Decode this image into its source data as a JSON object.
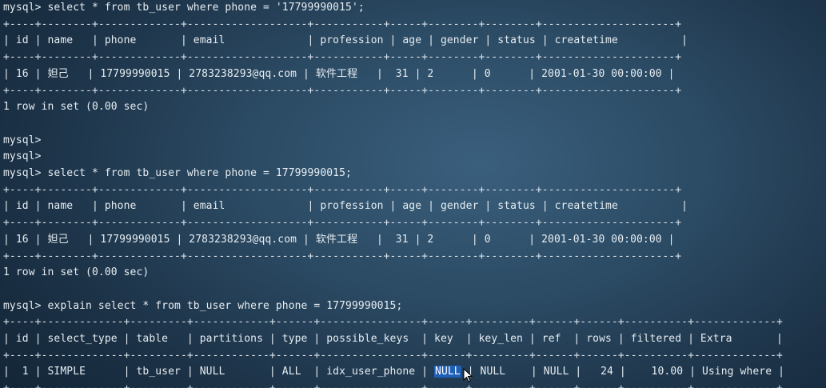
{
  "window": {
    "title": ""
  },
  "terminal": {
    "lines": [
      {
        "text": "mysql> select * from tb_user where phone = '17799990015';",
        "kind": "command"
      },
      {
        "text": "+----+--------+-------------+-------------------+-----------+-----+--------+--------+---------------------+",
        "kind": "border"
      },
      {
        "text": "| id | name   | phone       | email             | profession | age | gender | status | createtime          |",
        "kind": "row"
      },
      {
        "text": "+----+--------+-------------+-------------------+-----------+-----+--------+--------+---------------------+",
        "kind": "border"
      },
      {
        "text": "| 16 | 妲己   | 17799990015 | 2783238293@qq.com | 软件工程   |  31 | 2      | 0      | 2001-01-30 00:00:00 |",
        "kind": "row"
      },
      {
        "text": "+----+--------+-------------+-------------------+-----------+-----+--------+--------+---------------------+",
        "kind": "border"
      },
      {
        "text": "1 row in set (0.00 sec)",
        "kind": "output"
      },
      {
        "text": "",
        "kind": "blank"
      },
      {
        "text": "mysql>",
        "kind": "command"
      },
      {
        "text": "mysql>",
        "kind": "command"
      },
      {
        "text": "mysql> select * from tb_user where phone = 17799990015;",
        "kind": "command"
      },
      {
        "text": "+----+--------+-------------+-------------------+-----------+-----+--------+--------+---------------------+",
        "kind": "border"
      },
      {
        "text": "| id | name   | phone       | email             | profession | age | gender | status | createtime          |",
        "kind": "row"
      },
      {
        "text": "+----+--------+-------------+-------------------+-----------+-----+--------+--------+---------------------+",
        "kind": "border"
      },
      {
        "text": "| 16 | 妲己   | 17799990015 | 2783238293@qq.com | 软件工程   |  31 | 2      | 0      | 2001-01-30 00:00:00 |",
        "kind": "row"
      },
      {
        "text": "+----+--------+-------------+-------------------+-----------+-----+--------+--------+---------------------+",
        "kind": "border"
      },
      {
        "text": "1 row in set (0.00 sec)",
        "kind": "output"
      },
      {
        "text": "",
        "kind": "blank"
      },
      {
        "text": "mysql> explain select * from tb_user where phone = 17799990015;",
        "kind": "command"
      },
      {
        "text": "+----+-------------+---------+------------+------+----------------+------+---------+------+------+----------+-------------+",
        "kind": "border"
      },
      {
        "text": "| id | select_type | table   | partitions | type | possible_keys  | key  | key_len | ref  | rows | filtered | Extra       |",
        "kind": "row"
      },
      {
        "text": "+----+-------------+---------+------------+------+----------------+------+---------+------+------+----------+-------------+",
        "kind": "border"
      },
      {
        "text": "|  1 | SIMPLE      | tb_user | NULL       | ALL  | idx_user_phone | ",
        "kind": "row",
        "highlight": "NULL",
        "after": " | NULL    | NULL |   24 |    10.00 | Using where |"
      },
      {
        "text": "+----+-------------+---------+------------+------+----------------+------+---------+------+------+----------+-------------+",
        "kind": "border"
      }
    ]
  },
  "colors": {
    "text": "#e6edf2",
    "selection": "#1e5fb8",
    "background": "#2b4a63"
  },
  "icons": {
    "pointer": "mouse-pointer-icon"
  }
}
